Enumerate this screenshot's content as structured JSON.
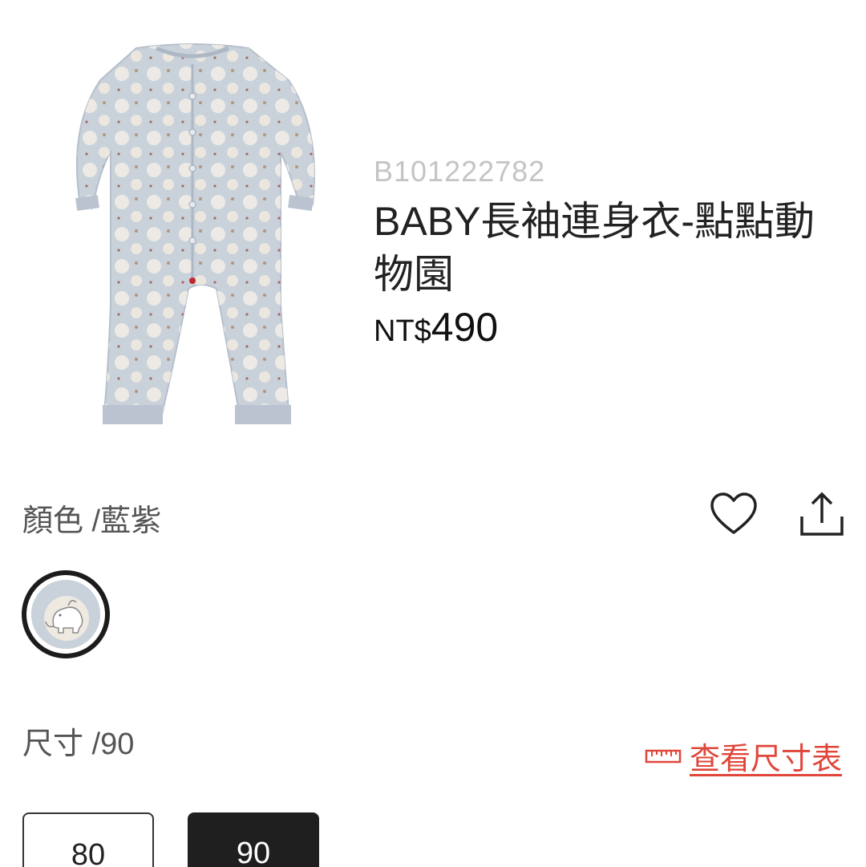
{
  "product": {
    "sku": "B101222782",
    "title": "BABY長袖連身衣-點點動物園",
    "price_currency": "NT$",
    "price_value": "490",
    "image_icon": "romper-image"
  },
  "color": {
    "label": "顏色 /藍紫",
    "swatch_icon": "elephant-pattern-swatch"
  },
  "actions": {
    "favorite_icon": "heart-icon",
    "share_icon": "share-icon"
  },
  "size": {
    "label": "尺寸 /90",
    "chart_link": "查看尺寸表",
    "chart_icon": "ruler-icon",
    "options": [
      {
        "label": "80",
        "selected": false
      },
      {
        "label": "90",
        "selected": true
      }
    ]
  },
  "colors": {
    "accent_red": "#e0463a",
    "selected_bg": "#1f1f1f",
    "romper_blue": "#c9d1db"
  }
}
